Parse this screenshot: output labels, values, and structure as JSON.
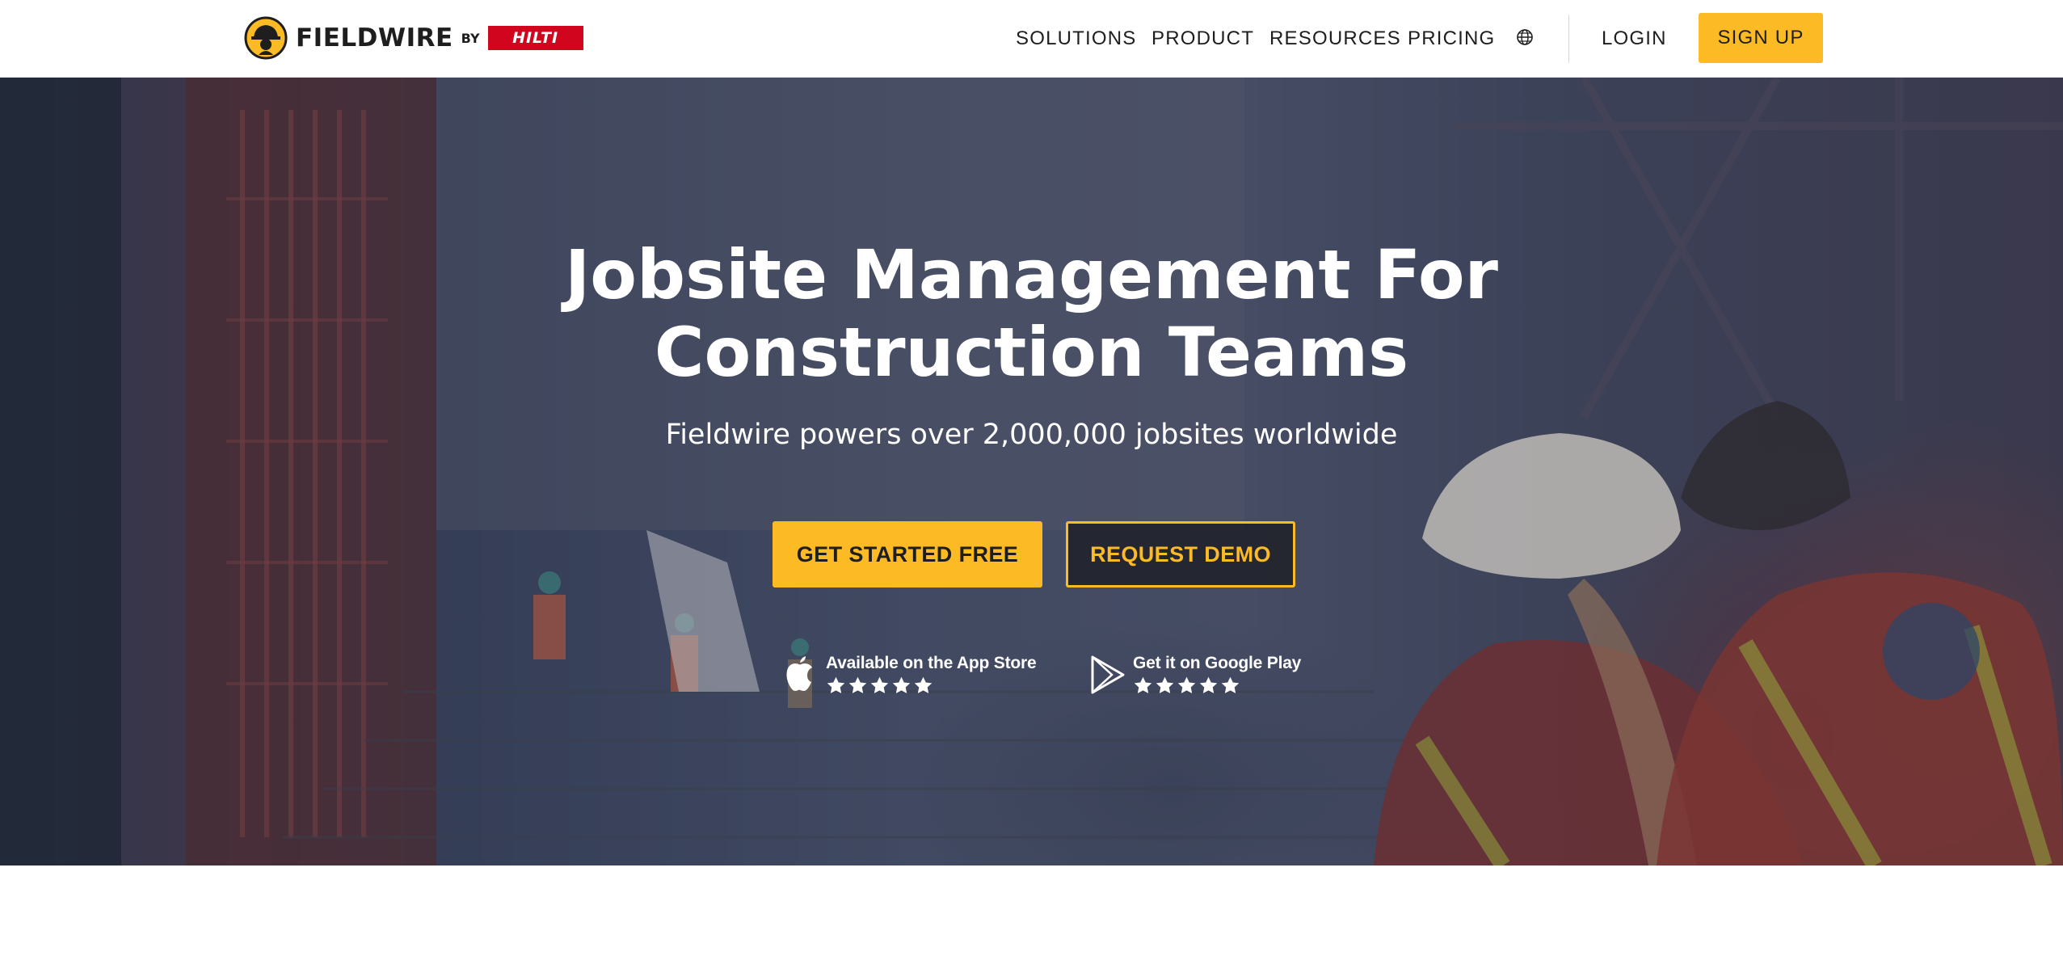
{
  "header": {
    "logo_text": "FIELDWIRE",
    "logo_by": "BY",
    "hilti_text": "HILTI",
    "nav": {
      "solutions": "SOLUTIONS",
      "product": "PRODUCT",
      "resources": "RESOURCES",
      "pricing": "PRICING",
      "login": "LOGIN",
      "signup": "SIGN UP"
    },
    "icons": {
      "language": "globe-icon"
    }
  },
  "hero": {
    "title_line1": "Jobsite Management For",
    "title_line2": "Construction Teams",
    "subtitle": "Fieldwire powers over 2,000,000 jobsites worldwide",
    "cta_primary": "GET STARTED FREE",
    "cta_secondary": "REQUEST DEMO",
    "app_store": {
      "label": "Available on the App Store",
      "icon": "apple-icon",
      "rating_stars": 5
    },
    "google_play": {
      "label": "Get it on Google Play",
      "icon": "google-play-icon",
      "rating_stars": 5
    }
  },
  "colors": {
    "accent": "#fcbb25",
    "hilti_red": "#d2051e",
    "text_dark": "#1e1e1e",
    "hero_overlay": "#2d3755"
  }
}
